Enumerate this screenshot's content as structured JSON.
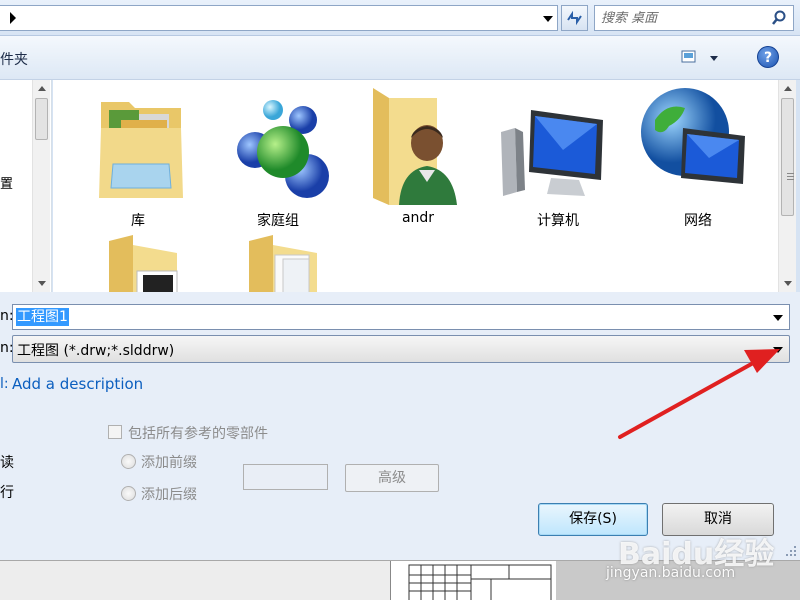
{
  "address_bar": {
    "search_placeholder": "搜索 桌面"
  },
  "toolbar": {
    "folder_label": "件夹",
    "help_label": "?"
  },
  "nav": {
    "partial_label": "置"
  },
  "files": [
    {
      "name": "库",
      "icon": "library-folder-icon"
    },
    {
      "name": "家庭组",
      "icon": "homegroup-icon"
    },
    {
      "name": "andr",
      "icon": "user-folder-icon"
    },
    {
      "name": "计算机",
      "icon": "computer-icon"
    },
    {
      "name": "网络",
      "icon": "network-icon"
    }
  ],
  "form": {
    "filename_label_tail": "n:",
    "filename_value": "工程图1",
    "filetype_label_tail": "n:",
    "filetype_value": "工程图 (*.drw;*.slddrw)",
    "desc_label_tail": "l:",
    "add_description": "Add a description",
    "include_refs": "包括所有参考的零部件",
    "left_partial_1": "读",
    "left_partial_2": "行",
    "add_prefix": "添加前缀",
    "add_suffix": "添加后缀",
    "advanced": "高级",
    "save": "保存(S)",
    "cancel": "取消"
  },
  "watermark": {
    "logo": "Baidu经验",
    "url": "jingyan.baidu.com"
  },
  "colors": {
    "accent_link": "#0c5fbf",
    "selection": "#3399ff",
    "annotation_arrow": "#e02020"
  }
}
